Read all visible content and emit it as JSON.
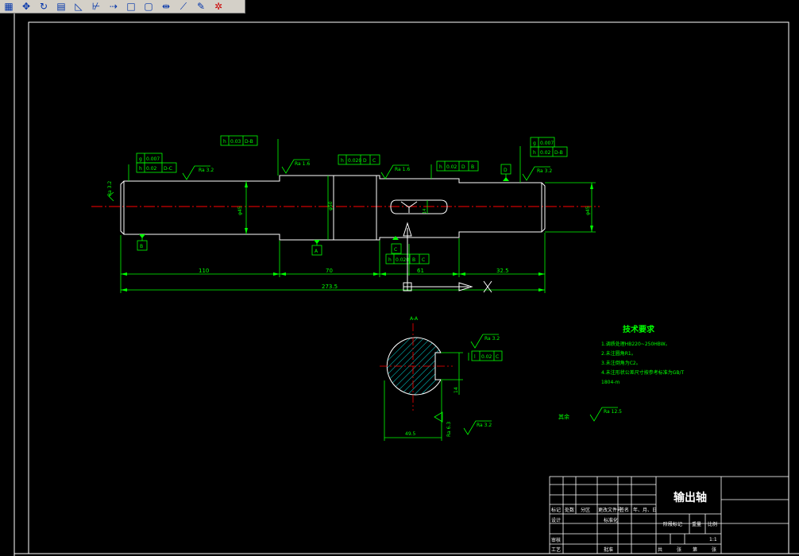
{
  "toolbar": {
    "icons": [
      {
        "name": "grid-icon",
        "glyph": "▦"
      },
      {
        "name": "move-icon",
        "glyph": "✥"
      },
      {
        "name": "rotate-icon",
        "glyph": "↻"
      },
      {
        "name": "copy-icon",
        "glyph": "▤"
      },
      {
        "name": "mirror-icon",
        "glyph": "◺"
      },
      {
        "name": "trim-icon",
        "glyph": "⊬"
      },
      {
        "name": "extend-icon",
        "glyph": "⇢"
      },
      {
        "name": "rectangle-icon",
        "glyph": "□"
      },
      {
        "name": "square-icon",
        "glyph": "▢"
      },
      {
        "name": "stretch-icon",
        "glyph": "⇹"
      },
      {
        "name": "line-tool-icon",
        "glyph": "⟋"
      },
      {
        "name": "pen-icon",
        "glyph": "✎"
      },
      {
        "name": "explode-icon",
        "glyph": "✲"
      }
    ]
  },
  "colors": {
    "background": "#000000",
    "lines": "#ffffff",
    "annotations": "#00ff00",
    "centerline": "#ff0000",
    "hatch": "#00ffff"
  },
  "drawing": {
    "dims": {
      "d1": "110",
      "d2": "70",
      "d3": "61",
      "d4": "32.5",
      "total": "273.5",
      "dia_left": "φ45",
      "dia_mid": "φ50",
      "dia_right": "φ45"
    },
    "roughness": {
      "r1": "Ra 3.2",
      "r2": "Ra 3.2",
      "r3": "Ra 1.6",
      "r4": "Ra 1.6",
      "r5": "Ra 3.2",
      "r6": "Ra 3.2",
      "r7": "Ra 3.2",
      "r8": "Ra 6.3",
      "r9": "Ra 12.5",
      "rest_label": "其余"
    },
    "tolerances": {
      "t1_sym": "g",
      "t1_val": "0.007",
      "t2_sym": "h",
      "t2_val": "0.02",
      "t2_ref": "D-C",
      "t3_sym": "h",
      "t3_val": "0.03",
      "t3_ref": "D-B",
      "t4_sym": "h",
      "t4_val": "0.020",
      "t4_ref1": "D",
      "t4_ref2": "C",
      "t5_sym": "h",
      "t5_val": "0.02",
      "t5_ref1": "D",
      "t5_ref2": "B",
      "t6_sym": "g",
      "t6_val": "0.007",
      "t7_sym": "h",
      "t7_val": "0.02",
      "t7_ref": "D-B",
      "t8_sym": "h",
      "t8_val": "0.020",
      "t8_ref1": "B",
      "t8_ref2": "C",
      "t9_sym": "l",
      "t9_val": "0.02",
      "t9_ref": "C"
    },
    "datums": {
      "b": "B",
      "a": "A",
      "c": "C",
      "d": "D"
    },
    "ucs_x": "X",
    "section_label": "A-A",
    "section_dims": {
      "width": "49.5",
      "key": "14"
    },
    "tech": {
      "title": "技术要求",
      "items": [
        "1.调质处理HB220~250HBW。",
        "2.未注圆角R1。",
        "3.未注倒角为C2。",
        "4.未注形状公差尺寸按参考标准为GB/T",
        "1804-m"
      ]
    }
  },
  "title_block": {
    "part_name": "输出轴",
    "labels": [
      "标记",
      "处数",
      "分区",
      "更改文件号",
      "签名",
      "年、月、日"
    ],
    "design": "设计",
    "standard": "标准化",
    "check": "审核",
    "process": "工艺",
    "approve": "批准",
    "stage": "阶段标记",
    "weight": "重量",
    "scale_label": "比例",
    "scale": "1:1",
    "sheets": "共",
    "sheet_of": "张",
    "sheet": "第",
    "sheet_of2": "张"
  }
}
